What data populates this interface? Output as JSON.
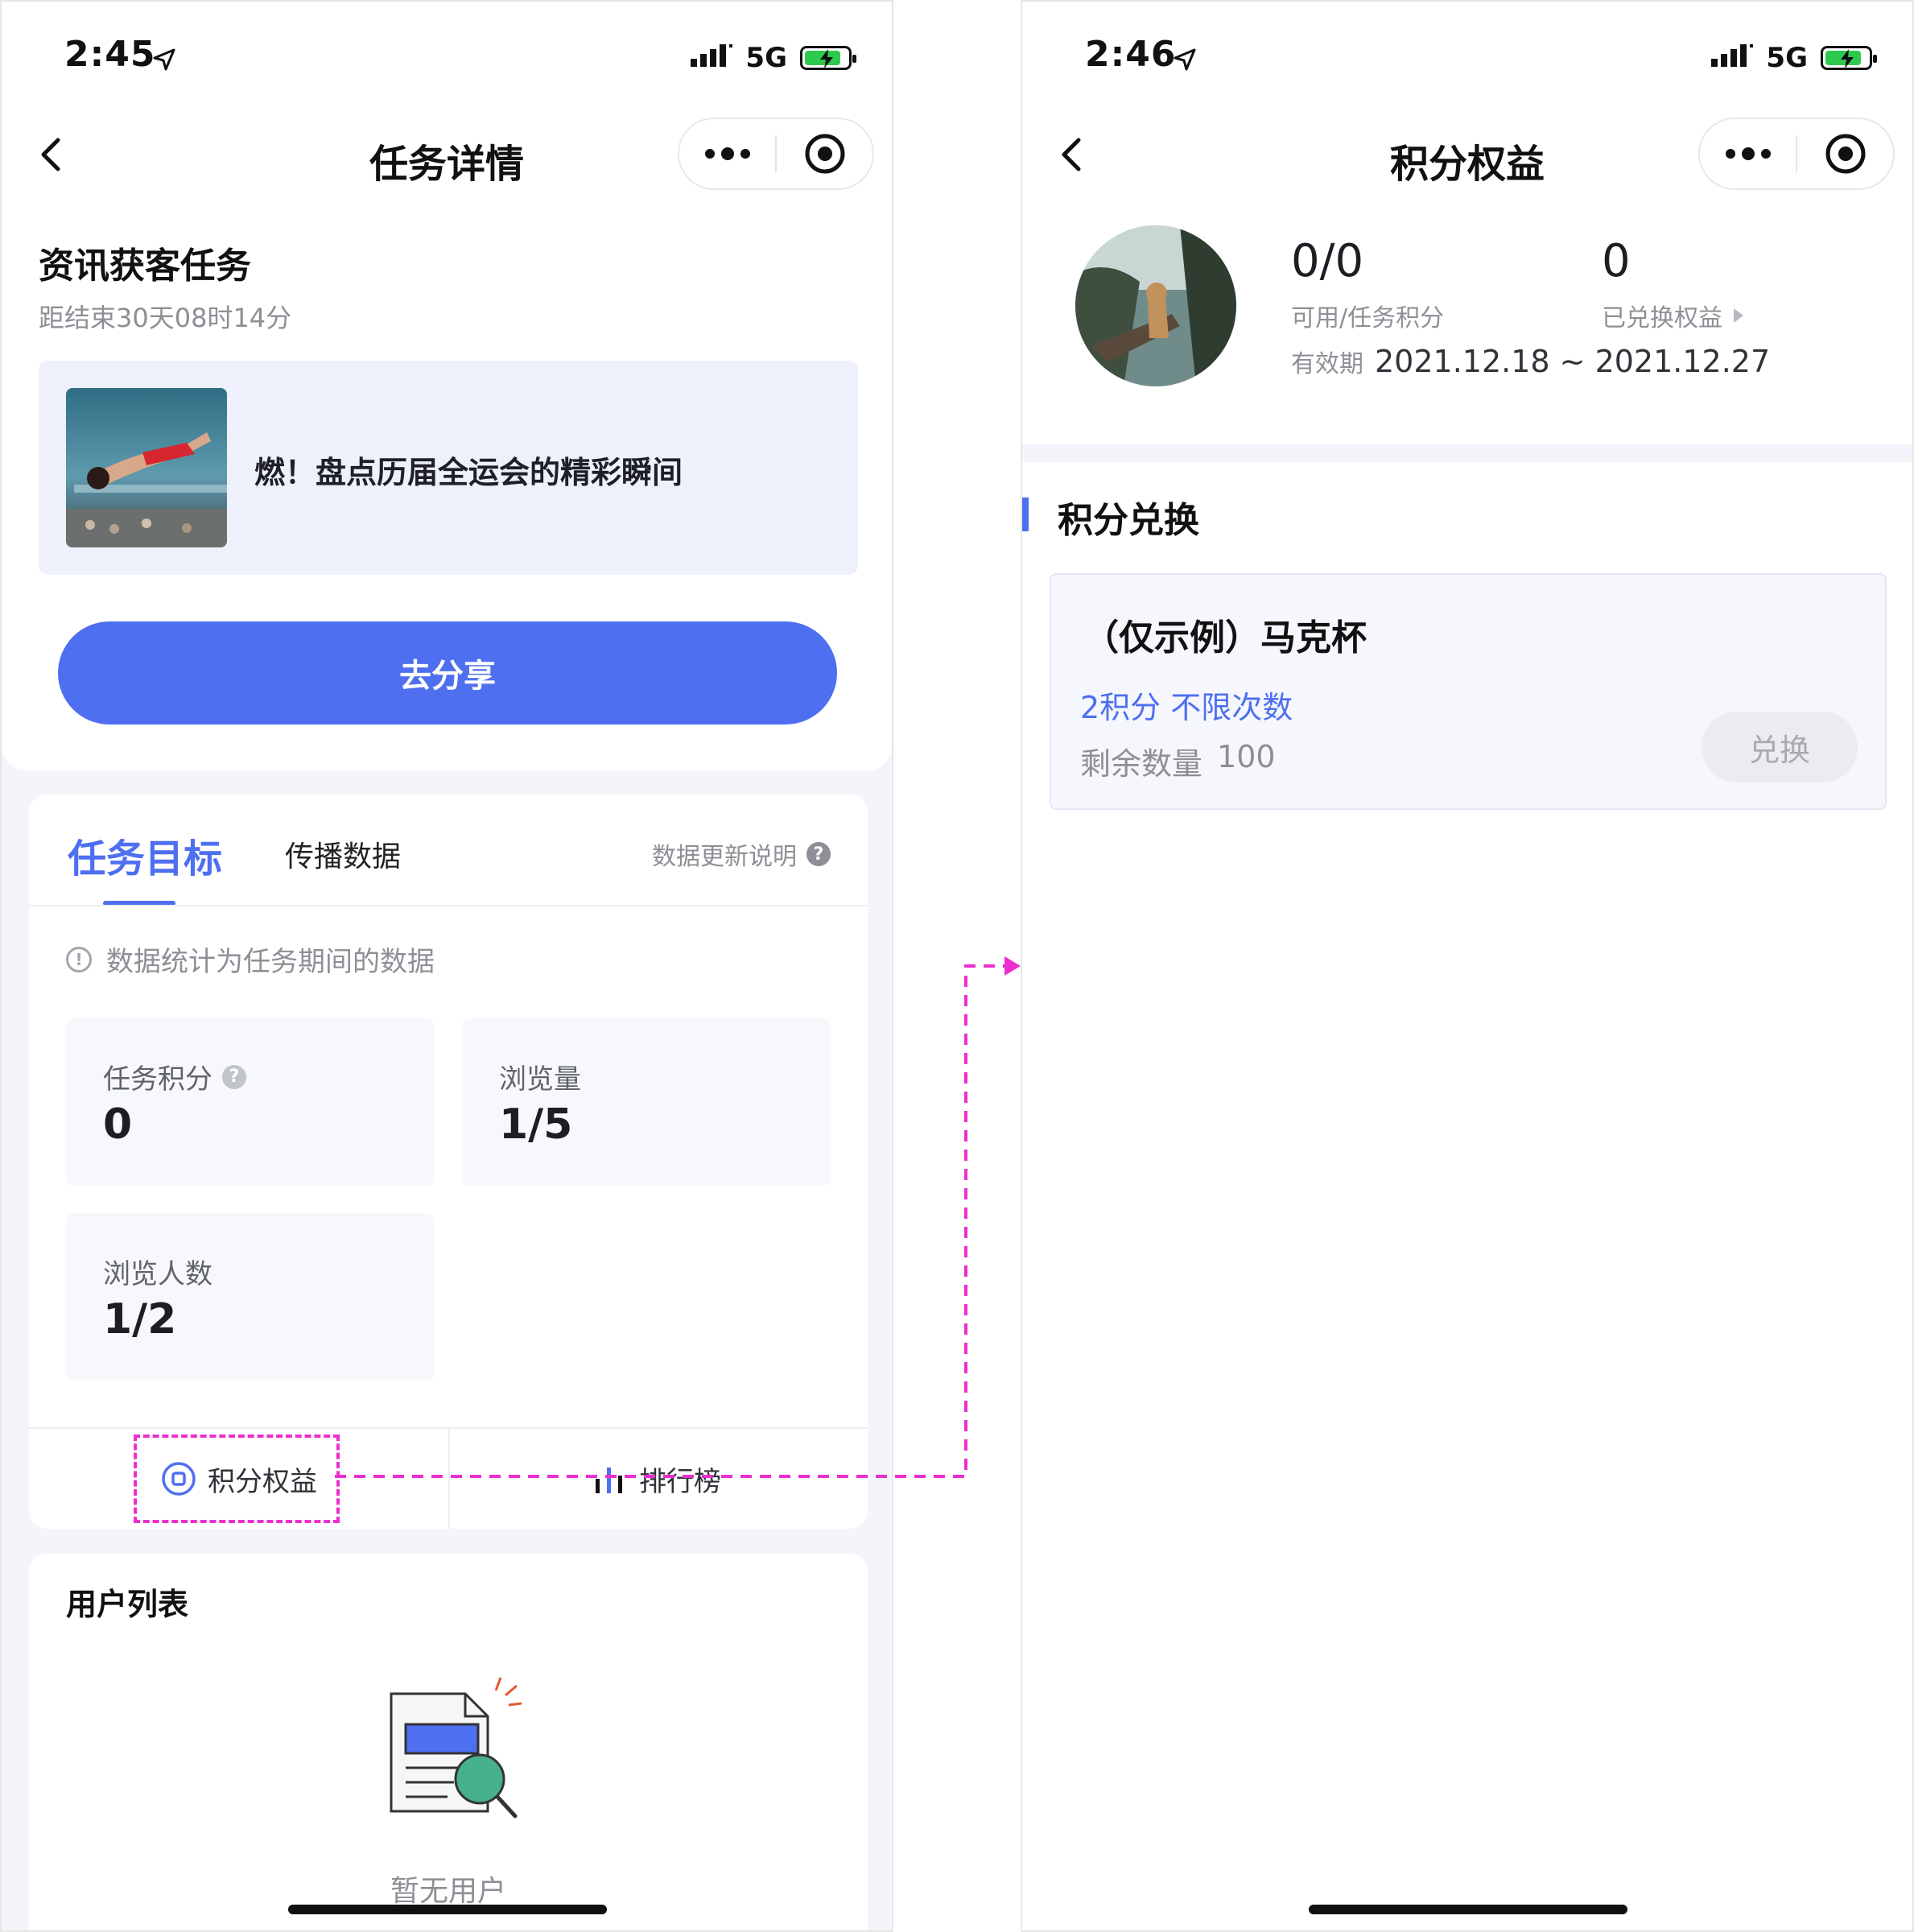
{
  "left": {
    "status": {
      "time": "2:45",
      "network": "5G"
    },
    "nav": {
      "title": "任务详情"
    },
    "task": {
      "title": "资讯获客任务",
      "countdown": "距结束30天08时14分",
      "article_title": "燃！盘点历届全运会的精彩瞬间",
      "share_label": "去分享"
    },
    "stats": {
      "tabs": [
        "任务目标",
        "传播数据"
      ],
      "help_label": "数据更新说明",
      "note": "数据统计为任务期间的数据",
      "metrics": [
        {
          "label": "任务积分",
          "value": "0"
        },
        {
          "label": "浏览量",
          "value": "1/5"
        },
        {
          "label": "浏览人数",
          "value": "1/2"
        }
      ],
      "footer": {
        "points_label": "积分权益",
        "ranking_label": "排行榜"
      }
    },
    "users": {
      "title": "用户列表",
      "empty": "暂无用户"
    }
  },
  "right": {
    "status": {
      "time": "2:46",
      "network": "5G"
    },
    "nav": {
      "title": "积分权益"
    },
    "summary": {
      "points_value": "0/0",
      "points_label": "可用/任务积分",
      "redeemed_value": "0",
      "redeemed_label": "已兑换权益",
      "validity_label": "有效期",
      "validity_value": "2021.12.18 ~ 2021.12.27"
    },
    "exchange": {
      "section_title": "积分兑换",
      "item_name": "（仅示例）马克杯",
      "item_cost": "2积分 不限次数",
      "remaining_label": "剩余数量",
      "remaining_value": "100",
      "redeem_label": "兑换"
    }
  },
  "colors": {
    "accent": "#4e6ff0",
    "highlight": "#ec2ecf",
    "page_bg": "#f4f5fa",
    "battery": "#2ec94f"
  },
  "icons": [
    "location-arrow-icon",
    "signal-icon",
    "battery-charging-icon",
    "back-chevron-icon",
    "more-dots-icon",
    "close-target-icon",
    "question-icon",
    "info-icon",
    "points-icon",
    "ranking-icon",
    "empty-document-icon",
    "triangle-right-icon"
  ]
}
